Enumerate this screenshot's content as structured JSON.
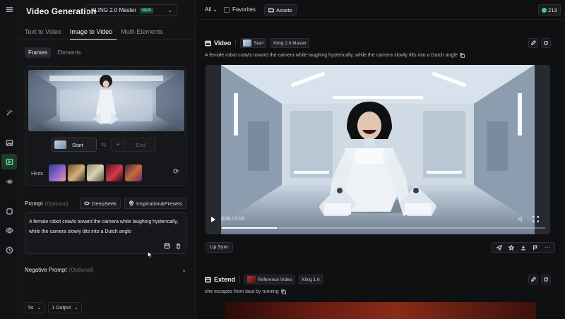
{
  "app": {
    "title": "Video Generation",
    "model": "KLING 2.0 Master",
    "model_badge": "NEW"
  },
  "tabs": [
    "Text to Video",
    "Image to Video",
    "Multi-Elements"
  ],
  "subtabs": [
    "Frames",
    "Elements"
  ],
  "frames": {
    "start_label": "Start",
    "end_label": "End"
  },
  "hints_label": "Hints",
  "prompt": {
    "label": "Prompt",
    "optional": "(Optional)",
    "deepseek_label": "DeepSeek",
    "inspiration_label": "Inspiration&Presets",
    "text_line1": "A female robot crawls toward the camera while laughing hysterically,",
    "text_line2": "while the camera slowly tilts into a Dutch angle"
  },
  "negative_prompt": {
    "label": "Negative Prompt",
    "optional": "(Optional)"
  },
  "bottom": {
    "duration": "5s",
    "outputs": "1 Output"
  },
  "topbar": {
    "filter_all": "All",
    "favorites": "Favorites",
    "assets": "Assets",
    "credits": "213"
  },
  "video_card": {
    "title": "Video",
    "start_tag": "Start",
    "model_tag": "Kling 2.0 Master",
    "description": "A female robot crawls toward the camera while laughing hysterically, while the camera slowly tilts into a Dutch angle",
    "time": "0:00 / 0:05",
    "progress": 0.17,
    "lip_sync": "Lip Sync"
  },
  "extend_card": {
    "title": "Extend",
    "ref_tag": "Reference Video",
    "model_tag": "Kling 1.6",
    "description": "she escapes from lava by running"
  },
  "colors": {
    "accent_green": "#4ee08a",
    "background": "#0d0e10"
  }
}
